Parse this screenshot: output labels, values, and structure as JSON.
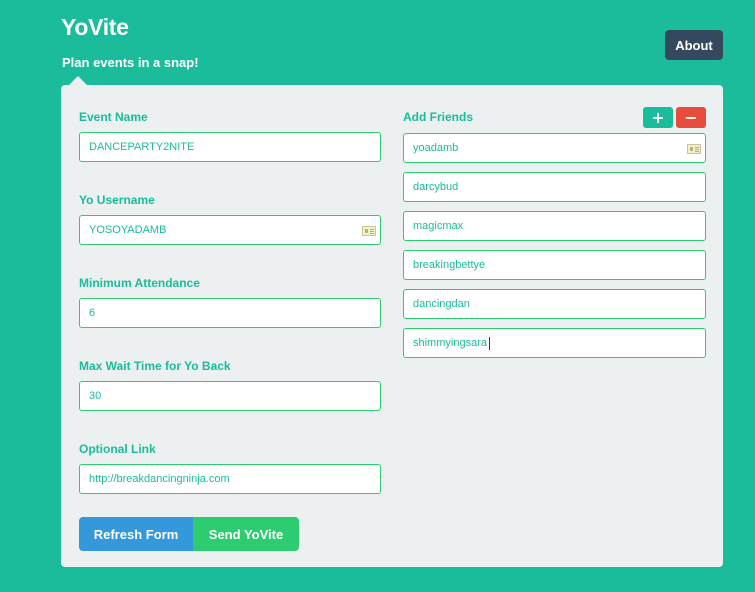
{
  "header": {
    "brand": "YoVite",
    "tagline": "Plan events in a snap!",
    "about_label": "About"
  },
  "form": {
    "event_name": {
      "label": "Event Name",
      "value": "DANCEPARTY2NITE"
    },
    "yo_username": {
      "label": "Yo Username",
      "value": "YOSOYADAMB"
    },
    "min_attendance": {
      "label": "Minimum Attendance",
      "value": "6"
    },
    "max_wait": {
      "label": "Max Wait Time for Yo Back",
      "value": "30"
    },
    "optional_link": {
      "label": "Optional Link",
      "value": "http://breakdancingninja.com"
    }
  },
  "friends": {
    "label": "Add Friends",
    "add_label": "+",
    "remove_label": "−",
    "items": [
      "yoadamb",
      "darcybud",
      "magicmax",
      "breakingbettye",
      "dancingdan",
      "shimmyingsara"
    ]
  },
  "actions": {
    "refresh_label": "Refresh Form",
    "send_label": "Send YoVite"
  },
  "colors": {
    "background": "#1abc9c",
    "panel": "#ecf0f1",
    "accent_green": "#2ecc71",
    "refresh_blue": "#3498db",
    "remove_red": "#e74c3c",
    "about_dark": "#34495e"
  }
}
